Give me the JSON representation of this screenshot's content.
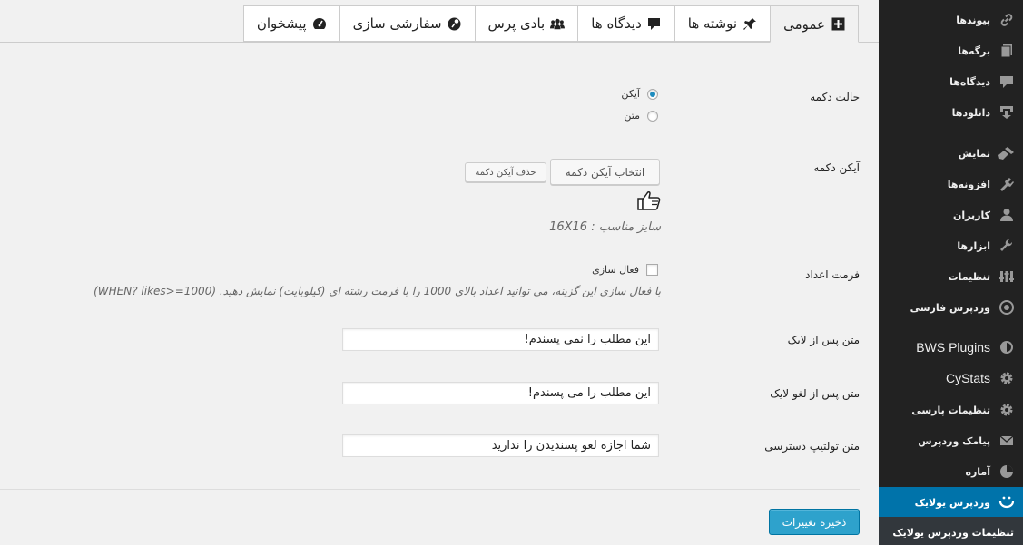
{
  "tabs": [
    {
      "label": "عمومی",
      "icon": "plus-square-icon",
      "active": true
    },
    {
      "label": "نوشته ها",
      "icon": "pin-icon"
    },
    {
      "label": "دیدگاه ها",
      "icon": "comment-icon"
    },
    {
      "label": "بادی پرس",
      "icon": "group-icon"
    },
    {
      "label": "سفارشی سازی",
      "icon": "palette-icon"
    },
    {
      "label": "پیشخوان",
      "icon": "dashboard-icon"
    }
  ],
  "sidebar": {
    "items": [
      {
        "label": "پیوندها",
        "icon": "links-icon"
      },
      {
        "label": "برگه‌ها",
        "icon": "pages-icon"
      },
      {
        "label": "دیدگاه‌ها",
        "icon": "comments-icon"
      },
      {
        "label": "دانلودها",
        "icon": "download-icon"
      },
      {
        "label": "نمایش",
        "icon": "appearance-icon"
      },
      {
        "label": "افزونه‌ها",
        "icon": "plugins-icon"
      },
      {
        "label": "کاربران",
        "icon": "users-icon"
      },
      {
        "label": "ابزارها",
        "icon": "tools-icon"
      },
      {
        "label": "تنظیمات",
        "icon": "settings-icon"
      },
      {
        "label": "وردپرس فارسی",
        "icon": "wp-farsi-icon"
      },
      {
        "label": "BWS Plugins",
        "icon": "bws-icon"
      },
      {
        "label": "CyStats",
        "icon": "gear-icon"
      },
      {
        "label": "تنظیمات پارسی",
        "icon": "gear-icon"
      },
      {
        "label": "پیامک وردپرس",
        "icon": "mail-icon"
      },
      {
        "label": "آماره",
        "icon": "stats-icon"
      },
      {
        "label": "وردپرس یولایک",
        "icon": "smile-icon"
      }
    ],
    "submenu_label": "تنظیمات وردپرس یولایک"
  },
  "form": {
    "button_mode_label": "حالت دکمه",
    "mode_icon_label": "آیکن",
    "mode_text_label": "متن",
    "button_icon_label": "آیکن دکمه",
    "select_icon_button": "انتخاب آیکن دکمه",
    "remove_icon_button": "حذف آیکن دکمه",
    "size_hint": "سایز مناسب : 16X16",
    "number_format_label": "فرمت اعداد",
    "enable_label": "فعال سازی",
    "format_desc": "با فعال سازی این گزینه، می توانید اعداد بالای 1000 را با فرمت رشته ای (کیلوبایت) نمایش دهید. (WHEN? likes>=1000)",
    "after_like_label": "متن پس از لایک",
    "after_like_value": "این مطلب را نمی پسندم!",
    "after_unlike_label": "متن پس از لغو لایک",
    "after_unlike_value": "این مطلب را می پسندم!",
    "tooltip_label": "متن تولتیپ دسترسی",
    "tooltip_value": "شما اجازه لغو پسندیدن را ندارید",
    "save_button": "ذخیره تغییرات"
  }
}
